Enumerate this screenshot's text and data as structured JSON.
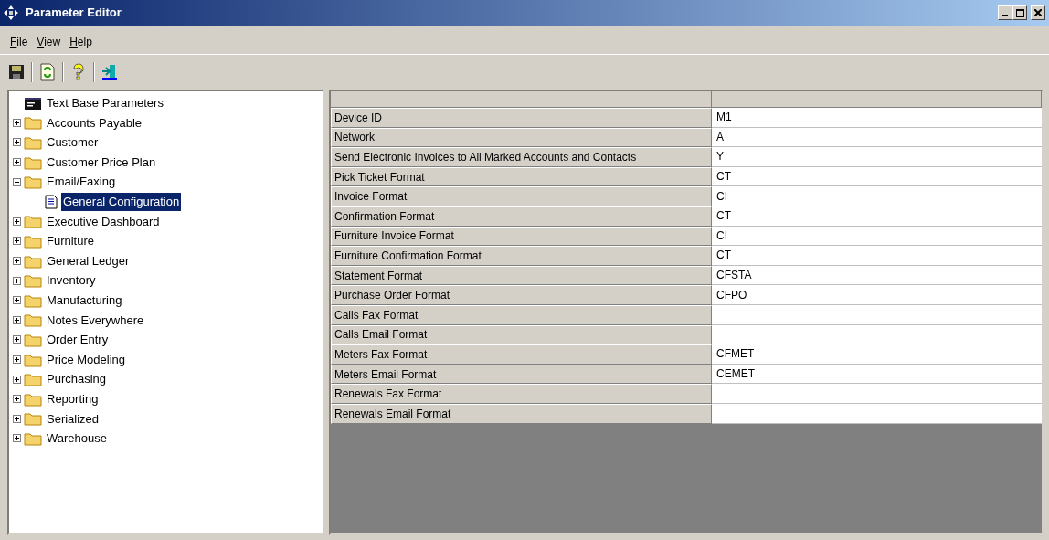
{
  "window": {
    "title": "Parameter Editor"
  },
  "menu": [
    {
      "label": "File"
    },
    {
      "label": "View"
    },
    {
      "label": "Help"
    }
  ],
  "toolbar": [
    {
      "kind": "save"
    },
    {
      "kind": "refresh"
    },
    {
      "kind": "help"
    },
    {
      "kind": "exit"
    }
  ],
  "tree": [
    {
      "label": "Text Base Parameters",
      "kind": "root",
      "selected": false
    },
    {
      "label": "Accounts Payable",
      "kind": "folder",
      "expanded": false,
      "selected": false
    },
    {
      "label": "Customer",
      "kind": "folder",
      "expanded": false,
      "selected": false
    },
    {
      "label": "Customer Price Plan",
      "kind": "folder",
      "expanded": false,
      "selected": false
    },
    {
      "label": "Email/Faxing",
      "kind": "folder",
      "expanded": true,
      "selected": false,
      "children": [
        {
          "label": "General Configuration",
          "kind": "page",
          "selected": true
        }
      ]
    },
    {
      "label": "Executive Dashboard",
      "kind": "folder",
      "expanded": false,
      "selected": false
    },
    {
      "label": "Furniture",
      "kind": "folder",
      "expanded": false,
      "selected": false
    },
    {
      "label": "General Ledger",
      "kind": "folder",
      "expanded": false,
      "selected": false
    },
    {
      "label": "Inventory",
      "kind": "folder",
      "expanded": false,
      "selected": false
    },
    {
      "label": "Manufacturing",
      "kind": "folder",
      "expanded": false,
      "selected": false
    },
    {
      "label": "Notes Everywhere",
      "kind": "folder",
      "expanded": false,
      "selected": false
    },
    {
      "label": "Order Entry",
      "kind": "folder",
      "expanded": false,
      "selected": false
    },
    {
      "label": "Price Modeling",
      "kind": "folder",
      "expanded": false,
      "selected": false
    },
    {
      "label": "Purchasing",
      "kind": "folder",
      "expanded": false,
      "selected": false
    },
    {
      "label": "Reporting",
      "kind": "folder",
      "expanded": false,
      "selected": false
    },
    {
      "label": "Serialized",
      "kind": "folder",
      "expanded": false,
      "selected": false
    },
    {
      "label": "Warehouse",
      "kind": "folder",
      "expanded": false,
      "selected": false
    }
  ],
  "grid": {
    "rows": [
      {
        "name": "Device ID",
        "value": "M1"
      },
      {
        "name": "Network",
        "value": "A"
      },
      {
        "name": "Send Electronic Invoices to All Marked Accounts and Contacts",
        "value": "Y"
      },
      {
        "name": "Pick Ticket Format",
        "value": "CT"
      },
      {
        "name": "Invoice Format",
        "value": "CI"
      },
      {
        "name": "Confirmation Format",
        "value": "CT"
      },
      {
        "name": "Furniture Invoice Format",
        "value": "CI"
      },
      {
        "name": "Furniture Confirmation Format",
        "value": "CT"
      },
      {
        "name": "Statement Format",
        "value": "CFSTA"
      },
      {
        "name": "Purchase Order Format",
        "value": "CFPO"
      },
      {
        "name": "Calls Fax Format"
      },
      {
        "name": "Calls Email Format"
      },
      {
        "name": "Meters Fax Format",
        "value": "CFMET"
      },
      {
        "name": "Meters Email Format",
        "value": "CEMET"
      },
      {
        "name": "Renewals Fax Format"
      },
      {
        "name": "Renewals Email Format"
      }
    ]
  }
}
